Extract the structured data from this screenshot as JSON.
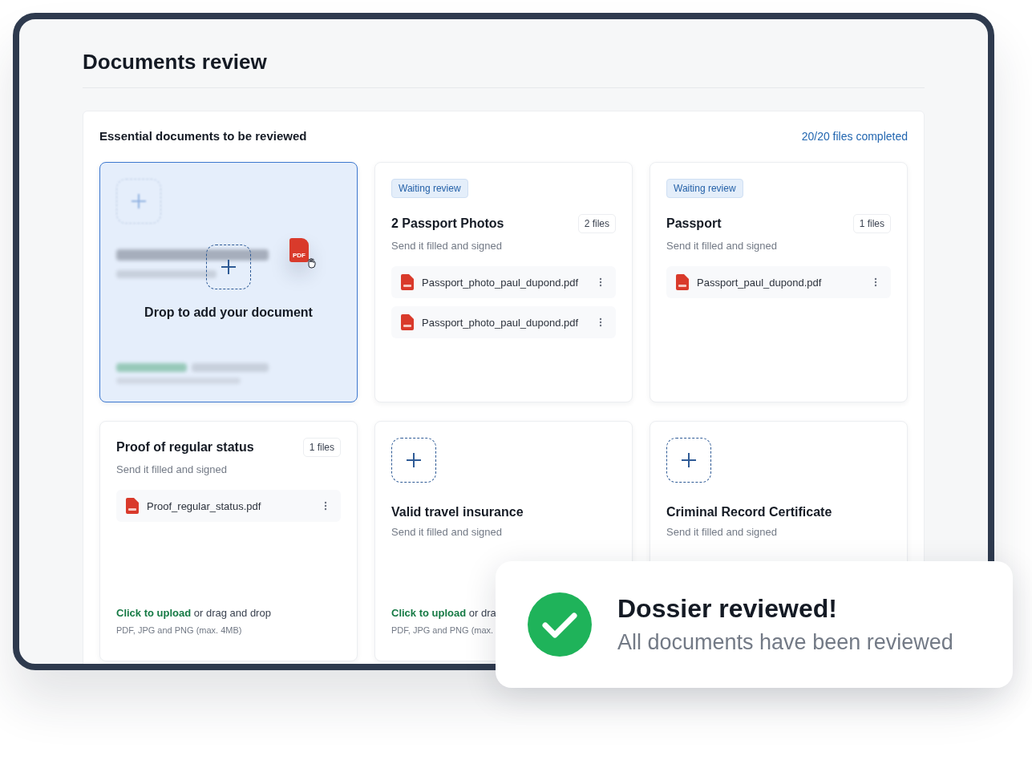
{
  "page": {
    "title": "Documents review"
  },
  "panel": {
    "title": "Essential documents to be reviewed",
    "progress_link": "20/20 files completed"
  },
  "cards": [
    {
      "kind": "drop",
      "drop_label": "Drop to add your document",
      "drag_file_label": "PDF"
    },
    {
      "kind": "files",
      "badge": "Waiting review",
      "title": "2 Passport Photos",
      "count": "2 files",
      "subtitle": "Send it filled and signed",
      "files": [
        "Passport_photo_paul_dupond.pdf",
        "Passport_photo_paul_dupond.pdf"
      ]
    },
    {
      "kind": "files",
      "badge": "Waiting review",
      "title": "Passport",
      "count": "1 files",
      "subtitle": "Send it filled and signed",
      "files": [
        "Passport_paul_dupond.pdf"
      ]
    },
    {
      "kind": "files",
      "title": "Proof of regular status",
      "count": "1 files",
      "subtitle": "Send it filled and signed",
      "files": [
        "Proof_regular_status.pdf"
      ],
      "upload": {
        "link": "Click to upload",
        "rest": " or drag and drop",
        "hint": "PDF, JPG and PNG (max. 4MB)"
      }
    },
    {
      "kind": "empty",
      "title": "Valid travel insurance",
      "subtitle": "Send it filled and signed",
      "upload": {
        "link": "Click to upload",
        "rest": " or dra",
        "hint": "PDF, JPG and PNG (max."
      }
    },
    {
      "kind": "empty",
      "title": "Criminal Record Certificate",
      "subtitle": "Send it filled and signed"
    }
  ],
  "toast": {
    "title": "Dossier reviewed!",
    "message": "All documents have been reviewed"
  }
}
